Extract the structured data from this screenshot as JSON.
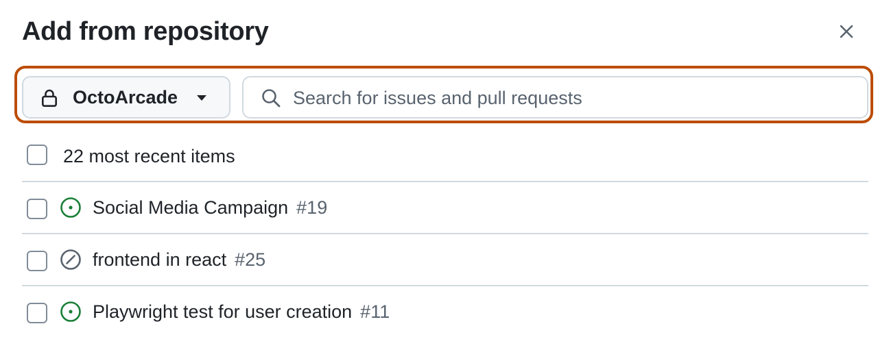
{
  "dialog": {
    "title": "Add from repository",
    "close_label": "Close"
  },
  "repo_selector": {
    "name": "OctoArcade",
    "visibility_icon": "lock-icon",
    "dropdown_icon": "triangle-down-icon"
  },
  "search": {
    "placeholder": "Search for issues and pull requests",
    "value": ""
  },
  "select_all": {
    "label": "22 most recent items",
    "checked": false
  },
  "items": [
    {
      "title": "Social Media Campaign",
      "number": "#19",
      "state": "open",
      "state_icon": "issue-opened-icon",
      "checked": false
    },
    {
      "title": "frontend in react",
      "number": "#25",
      "state": "closed-not-planned",
      "state_icon": "skip-icon",
      "checked": false
    },
    {
      "title": "Playwright test for user creation",
      "number": "#11",
      "state": "open",
      "state_icon": "issue-opened-icon",
      "checked": false
    }
  ],
  "colors": {
    "highlight_border": "#bc4c00",
    "open_state": "#1a7f37",
    "closed_state": "#59636e",
    "muted_text": "#59636e",
    "border": "#d1d9e0"
  }
}
